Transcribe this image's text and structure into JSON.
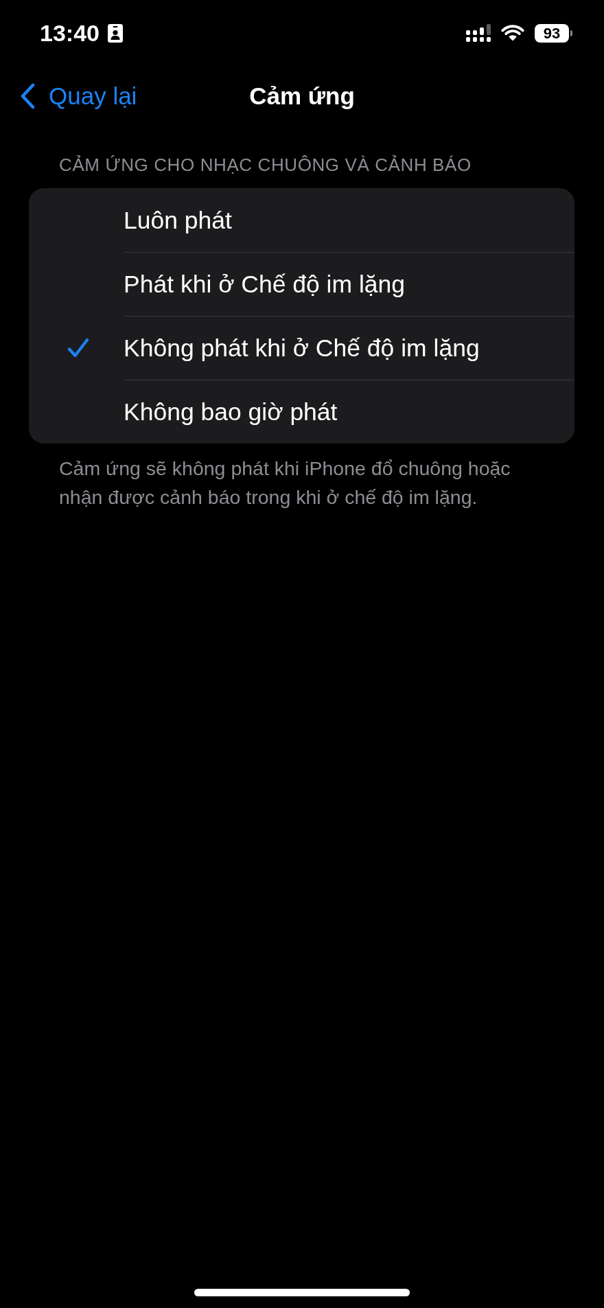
{
  "status_bar": {
    "time": "13:40",
    "battery": "93"
  },
  "nav": {
    "back": "Quay lại",
    "title": "Cảm ứng"
  },
  "section": {
    "header": "CẢM ỨNG CHO NHẠC CHUÔNG VÀ CẢNH BÁO",
    "options": [
      {
        "label": "Luôn phát",
        "selected": false
      },
      {
        "label": "Phát khi ở Chế độ im lặng",
        "selected": false
      },
      {
        "label": "Không phát khi ở Chế độ im lặng",
        "selected": true
      },
      {
        "label": "Không bao giờ phát",
        "selected": false
      }
    ],
    "footer": "Cảm ứng sẽ không phát khi iPhone đổ chuông hoặc nhận được cảnh báo trong khi ở chế độ im lặng."
  }
}
